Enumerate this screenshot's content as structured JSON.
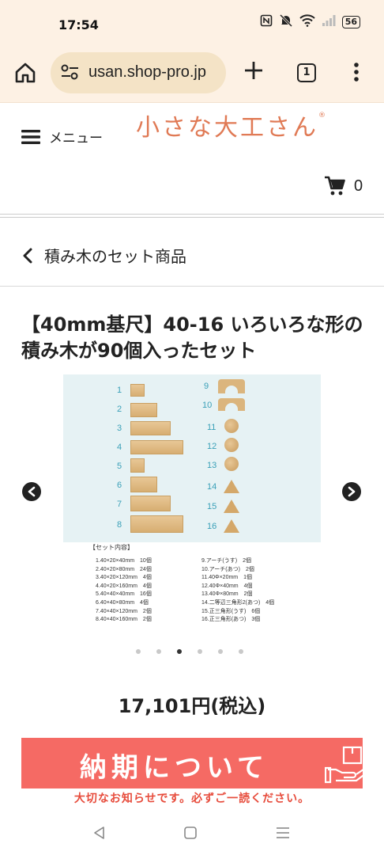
{
  "status_bar": {
    "time": "17:54",
    "battery": "56",
    "icons": [
      "nfc-icon",
      "mute-icon",
      "wifi-icon",
      "signal-icon",
      "battery-icon"
    ]
  },
  "browser": {
    "url": "usan.shop-pro.jp",
    "tab_count": "1",
    "toolbar_bg": "#fdf1e4",
    "url_pill_bg": "#f4e3c6"
  },
  "site": {
    "logo_text": "小さな大工さん",
    "logo_mark": "®",
    "logo_color": "#e07a55",
    "menu_label": "メニュー",
    "cart_count": "0"
  },
  "breadcrumb": {
    "label": "積み木のセット商品"
  },
  "product": {
    "title": "【40mm基尺】40-16 いろいろな形の積み木が90個入ったセット",
    "price": "17,101円(税込)",
    "carousel": {
      "dot_count": 6,
      "active_index": 2
    },
    "image": {
      "numbers_left": [
        "1",
        "2",
        "3",
        "4",
        "5",
        "6",
        "7",
        "8"
      ],
      "numbers_right": [
        "9",
        "10",
        "11",
        "12",
        "13",
        "14",
        "15",
        "16"
      ],
      "set_title": "【セット内容】",
      "set_left": [
        "1.40×20×40mm　10個",
        "2.40×20×80mm　24個",
        "3.40×20×120mm　4個",
        "4.40×20×160mm　4個",
        "5.40×40×40mm　16個",
        "6.40×40×80mm　4個",
        "7.40×40×120mm　2個",
        "8.40×40×160mm　2個"
      ],
      "set_right": [
        "9.アーチ(うす)　2個",
        "10.アーチ(あつ)　2個",
        "11.40Φ×20mm　1個",
        "12.40Φ×40mm　4個",
        "13.40Φ×80mm　2個",
        "14.二等辺三角形2(あつ)　4個",
        "15.正三角形(うす)　6個",
        "16.正三角形(あつ)　3個"
      ]
    }
  },
  "banner": {
    "text": "納期について",
    "bg_color": "#f56a64",
    "notice": "大切なお知らせです。必ずご一読ください。"
  }
}
